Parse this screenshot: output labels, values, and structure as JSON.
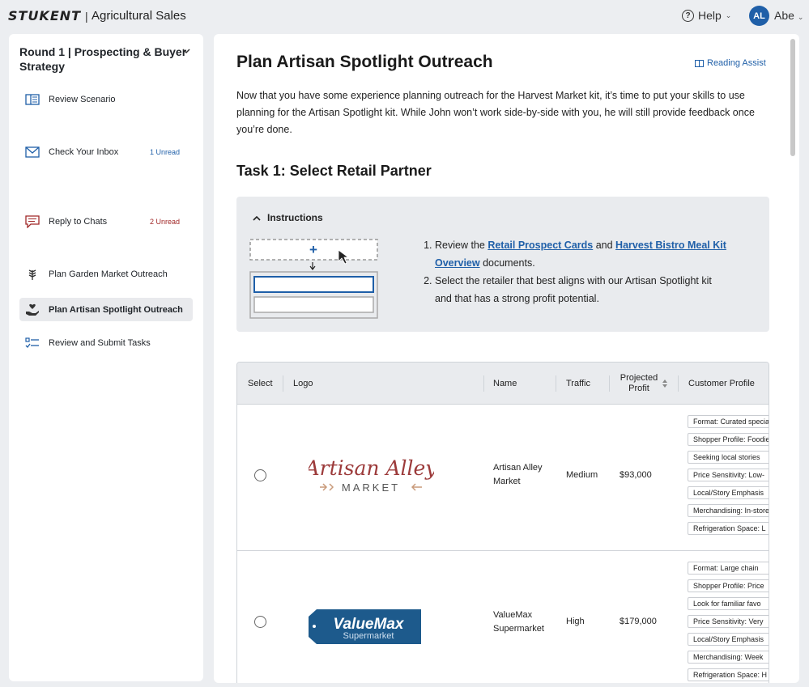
{
  "header": {
    "brand": "STUKENT",
    "separator": "|",
    "app_title": "Agricultural Sales",
    "help_label": "Help",
    "user_initials": "AL",
    "user_name": "Abe"
  },
  "sidebar": {
    "round_title": "Round 1 | Prospecting & Buyer Strategy",
    "items": [
      {
        "label": "Review Scenario",
        "badge": "",
        "icon": "book-icon"
      },
      {
        "label": "Check Your Inbox",
        "badge": "1 Unread",
        "icon": "mail-icon"
      },
      {
        "label": "Reply to Chats",
        "badge": "2 Unread",
        "icon": "chat-icon"
      },
      {
        "label": "Plan Garden Market Outreach",
        "badge": "",
        "icon": "wheat-icon"
      },
      {
        "label": "Plan Artisan Spotlight Outreach",
        "badge": "",
        "icon": "hand-heart-icon"
      },
      {
        "label": "Review and Submit Tasks",
        "badge": "",
        "icon": "checklist-icon"
      }
    ]
  },
  "main": {
    "title": "Plan Artisan Spotlight Outreach",
    "reading_assist": "Reading Assist",
    "intro": "Now that you have some experience planning outreach for the Harvest Market kit, it’s time to put your skills to use planning for the Artisan Spotlight kit. While John won’t work side-by-side with you, he will still provide feedback once you’re done.",
    "task_title": "Task 1: Select Retail Partner",
    "instructions": {
      "header": "Instructions",
      "step1_pre": "Review the ",
      "step1_link1": "Retail Prospect Cards",
      "step1_mid": " and ",
      "step1_link2": "Harvest Bistro Meal Kit Overview",
      "step1_post": " documents.",
      "step2": "Select the retailer that best aligns with our Artisan Spotlight kit and that has a strong profit potential."
    }
  },
  "table": {
    "headers": {
      "select": "Select",
      "logo": "Logo",
      "name": "Name",
      "traffic": "Traffic",
      "profit": "Projected Profit",
      "profile": "Customer Profile"
    },
    "rows": [
      {
        "logo_text_1": "Artisan Alley",
        "logo_text_2": "MARKET",
        "name": "Artisan Alley Market",
        "traffic": "Medium",
        "profit": "$93,000",
        "tags": [
          "Format: Curated specialty",
          "Shopper Profile: Foodies",
          "Seeking local stories",
          "Price Sensitivity: Low-",
          "Local/Story Emphasis",
          "Merchandising: In-store",
          "Refrigeration Space: L"
        ]
      },
      {
        "logo_text_1": "ValueMax",
        "logo_text_2": "Supermarket",
        "name": "ValueMax Supermarket",
        "traffic": "High",
        "profit": "$179,000",
        "tags": [
          "Format: Large chain",
          "Shopper Profile: Price",
          "Look for familiar favo",
          "Price Sensitivity: Very",
          "Local/Story Emphasis",
          "Merchandising: Week",
          "Refrigeration Space: H"
        ]
      }
    ]
  },
  "colors": {
    "accent": "#1f5fa8",
    "unread_red": "#a12828",
    "artisan_logo": "#9c3a3a",
    "valuemax_logo": "#1d5a8c"
  }
}
